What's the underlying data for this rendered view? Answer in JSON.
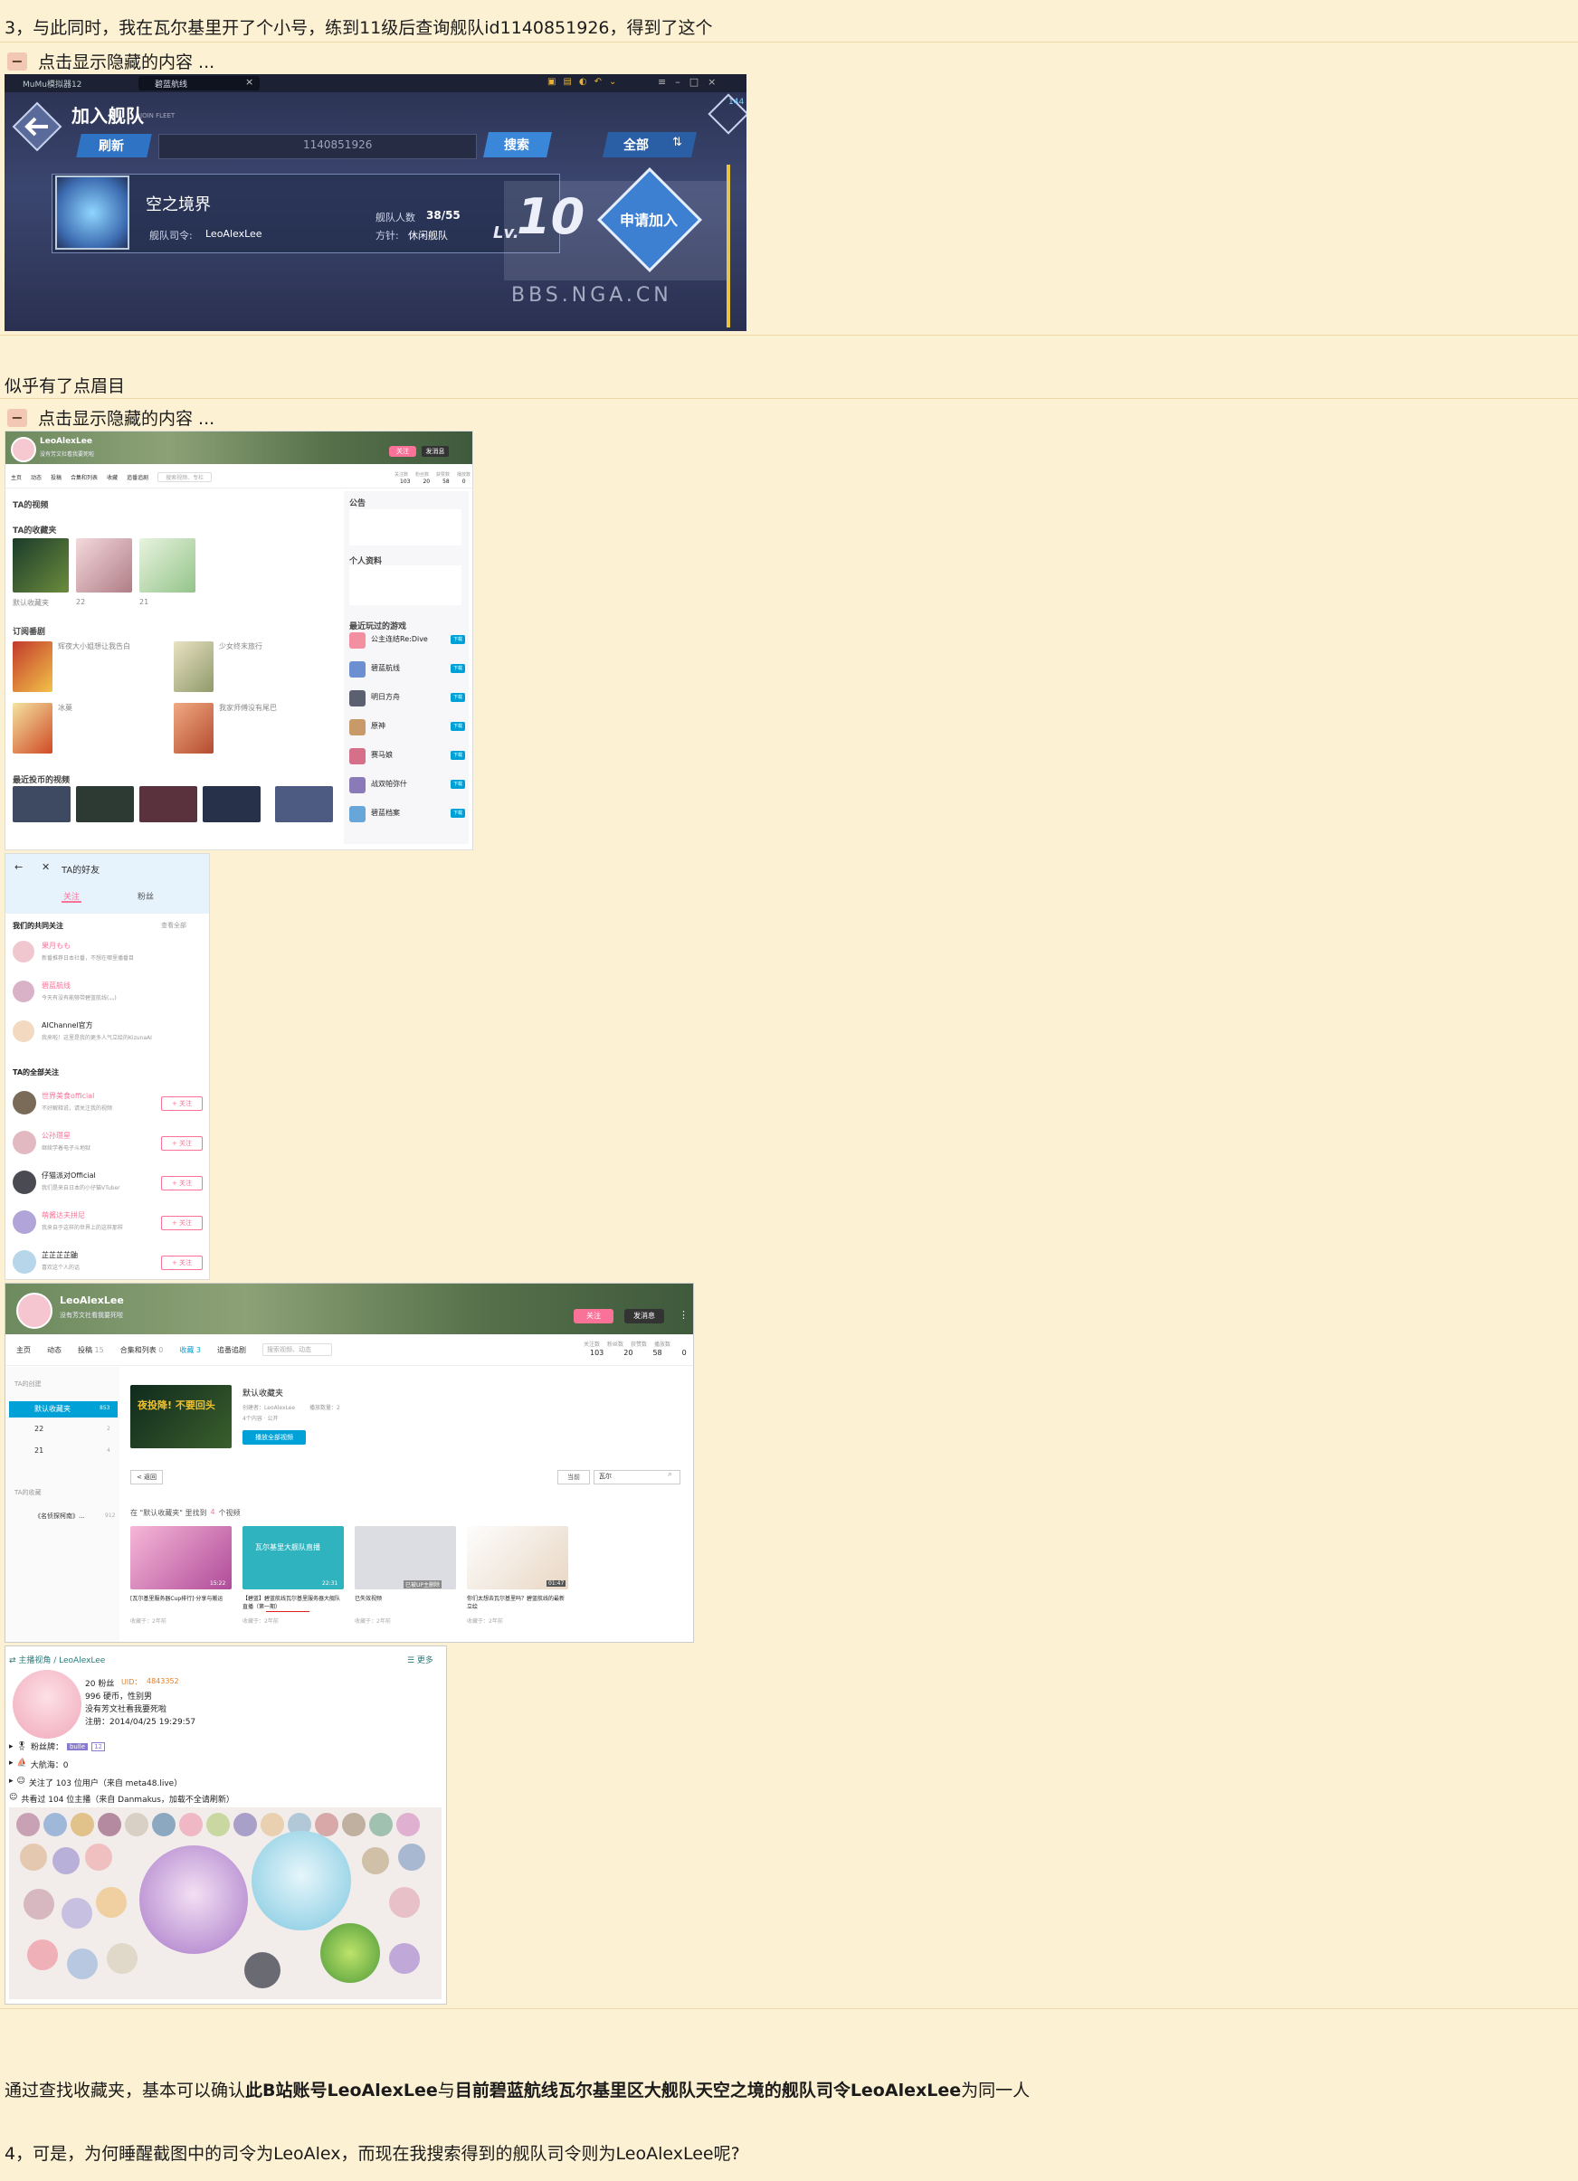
{
  "post": {
    "line_3": "3，与此同时，我在瓦尔基里开了个小号，练到11级后查询舰队id1140851926，得到了这个",
    "toggle_label": "点击显示隐藏的内容 ...",
    "toggle_symbol": "−",
    "mid_text": "似乎有了点眉目",
    "conclusion_prefix": "通过查找收藏夹，基本可以确认",
    "conclusion_bold_1": "此B站账号LeoAlexLee",
    "conclusion_mid": "与",
    "conclusion_bold_2": "目前碧蓝航线瓦尔基里区大舰队天空之境的舰队司令LeoAlexLee",
    "conclusion_suffix": "为同一人",
    "line_4": "4，可是，为何睡醒截图中的司令为LeoAlex，而现在我搜索得到的舰队司令则为LeoAlexLee呢?"
  },
  "game_shot": {
    "window_title": "MuMu模拟器12",
    "tab_title": "碧蓝航线",
    "page_title": "加入舰队",
    "page_subtitle": "JOIN FLEET",
    "refresh_button": "刷新",
    "search_value": "1140851926",
    "search_button": "搜索",
    "filter_button": "全部",
    "fleet_name": "空之境界",
    "commander_label": "舰队司令:",
    "commander_name": "LeoAlexLee",
    "member_label": "舰队人数",
    "member_count": "38/55",
    "policy_label": "方针:",
    "policy_value": "休闲舰队",
    "level_prefix": "Lv.",
    "level_value": "10",
    "apply_button": "申请加入",
    "corner_count": "144",
    "watermark": "BBS.NGA.CN"
  },
  "bili_shot": {
    "username": "LeoAlexLee",
    "signature": "没有芳文社看我要死啦",
    "follow_button": "关注",
    "message_button": "发消息",
    "nav": [
      "主页",
      "动态",
      "投稿",
      "合集和列表",
      "收藏",
      "追番追剧"
    ],
    "search_placeholder": "搜索视频、专栏",
    "stats_labels": [
      "关注数",
      "粉丝数",
      "获赞数",
      "播放数"
    ],
    "stats_values": [
      "103",
      "20",
      "58",
      "0"
    ],
    "section_videos": "TA的视频",
    "section_favs": "TA的收藏夹",
    "fav_names": [
      "默认收藏夹",
      "22",
      "21"
    ],
    "section_subs": "订阅番剧",
    "sub_items": [
      "辉夜大小姐想让我告白",
      "少女终末旅行",
      "冰菓",
      "我家师傅没有尾巴"
    ],
    "section_recent": "最近投币的视频",
    "section_notice": "公告",
    "section_info": "个人资料",
    "section_games": "最近玩过的游戏",
    "games": [
      "公主连结Re:Dive",
      "碧蓝航线",
      "明日方舟",
      "原神",
      "赛马娘",
      "战双帕弥什",
      "碧蓝档案"
    ],
    "game_button": "下载",
    "more_button": "更多"
  },
  "friends_shot": {
    "title": "TA的好友",
    "tab_following": "关注",
    "tab_fans": "粉丝",
    "common_header": "我们的共同关注",
    "common_more": "查看全部",
    "common": [
      {
        "name": "果月もも",
        "desc": "新番推荐日本社番，不想在哪里播番目"
      },
      {
        "name": "碧蓝航线",
        "desc": "今天有没有能够带碧蓝航线(灬)"
      },
      {
        "name": "AIChannel官方",
        "desc": "我来啦！这里是我的更多人气立绘的KizunaAI"
      }
    ],
    "all_header": "TA的全部关注",
    "all": [
      {
        "name": "世界美食official",
        "desc": "不好解释说，请关注我的视频"
      },
      {
        "name": "公孙瓒星",
        "desc": "继续学着电子斗地狱"
      },
      {
        "name": "仔猫派对Official",
        "desc": "我们是来自日本的小仔猫VTuber"
      },
      {
        "name": "萌酱达夫拼尼",
        "desc": "我来自于这样的世界上的这样那样"
      },
      {
        "name": "芷芷芷芷鼬",
        "desc": "喜欢这个人的话"
      }
    ],
    "follow_button": "+ 关注"
  },
  "fav_shot": {
    "username": "LeoAlexLee",
    "signature": "没有芳文社看我要死啦",
    "follow_button": "关注",
    "message_button": "发消息",
    "nav": [
      "主页",
      "动态",
      "投稿",
      "合集和列表",
      "收藏",
      "追番追剧"
    ],
    "nav_counts": [
      "",
      "",
      "15",
      "0",
      "3",
      ""
    ],
    "search_placeholder": "搜索视频、动态",
    "stats_labels": [
      "关注数",
      "粉丝数",
      "获赞数",
      "播放数"
    ],
    "stats_values": [
      "103",
      "20",
      "58",
      "0"
    ],
    "sidebar_header": "TA的创建",
    "folders": [
      {
        "name": "默认收藏夹",
        "count": "853"
      },
      {
        "name": "22",
        "count": "2"
      },
      {
        "name": "21",
        "count": "4"
      }
    ],
    "sidebar_header_2": "TA的收藏",
    "collected": [
      {
        "name": "《名侦探柯南》...",
        "count": "912"
      }
    ],
    "folder_title": "默认收藏夹",
    "folder_creator": "创建者：LeoAlexLee",
    "folder_plays": "播放数量：2",
    "folder_meta": "4个内容 · 公开",
    "play_all_button": "播放全部视频",
    "cover_text": "夜投降! 不要回头",
    "back_button": "< 返回",
    "sort_label": "当前",
    "search_value": "瓦尔",
    "result_text_prefix": "在 \"默认收藏夹\" 里找到",
    "result_count": "4",
    "result_text_suffix": "个视频",
    "videos": [
      {
        "title": "[瓦尔基里服务器Cup排行]·分享与搬运",
        "meta": "收藏于：2年前",
        "dur": "15:22"
      },
      {
        "title": "【碧蓝】碧蓝航线瓦尔基里服务器大舰队直播（第一期）",
        "meta": "收藏于：2年前",
        "dur": "22:31"
      },
      {
        "title": "已失效视频",
        "meta": "收藏于：2年前",
        "dur": "已被UP主删除"
      },
      {
        "title": "你们太想去瓦尔基里吗？碧蓝航线的最新立绘",
        "meta": "收藏于：2年前",
        "dur": "01:47"
      }
    ],
    "video2_cover_text": "瓦尔基里大舰队直播"
  },
  "live_shot": {
    "breadcrumb": "⇄ 主播视角 / LeoAlexLee",
    "more": "☰ 更多",
    "fans": "20 粉丝",
    "uid_label": "UID：",
    "uid": "4843352",
    "coins": "996 硬币，性别男",
    "signature": "没有芳文社看我要死啦",
    "register": "注册：2014/04/25 19:29:57",
    "medal_label": "粉丝牌：",
    "medal_value": "bulle",
    "medal_level": "12",
    "guard": "大航海：0",
    "following": "关注了 103 位用户（来自 meta48.live）",
    "watched": "共看过 104 位主播（来自 Danmakus，加载不全请刷新）"
  },
  "colors": {
    "page_bg": "#fdf1d3",
    "rule": "#efd6a6",
    "bili_pink": "#fb7299",
    "bili_blue": "#00a1d6"
  }
}
